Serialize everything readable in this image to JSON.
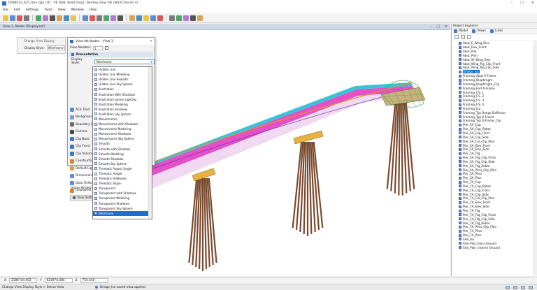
{
  "window": {
    "title": "D098035_A35_AS+.dgn [3D - V8 DGN, Read Only] - Bentley View V8i (SELECTseries 4)"
  },
  "menu": [
    "File",
    "Edit",
    "Settings",
    "Tools",
    "View",
    "Window",
    "Help"
  ],
  "view": {
    "title": "View 1, Model [Displayset]"
  },
  "change_view_display": {
    "title": "Change View Display",
    "label": "Display Style:",
    "value": "Wireframe"
  },
  "view_attributes": {
    "title": "View Attributes - View 1",
    "view_number_label": "View Number:",
    "view_number_value": "1",
    "section": "Presentation",
    "display_style_label": "Display Style:",
    "display_style_value": "Wireframe",
    "properties": [
      "ACS Triad",
      "Backgrounds",
      "Boundary Display",
      "Camera",
      "Clip Back",
      "Clip Front",
      "Clip Volume",
      "Constructions",
      "Default Lighting",
      "Dimensions",
      "Data Fields",
      "Displayset"
    ],
    "global_brightness": "Global Brightness",
    "view_settings": "View Settings"
  },
  "display_styles": [
    "Hidden Line",
    "Hidden Line Modeling",
    "Hidden Line Realistic",
    "Hidden Line Sky Sphere",
    "Illustration",
    "Illustration With Shadows",
    "Illustration Ignore Lighting",
    "Illustration Modeling",
    "Illustration Shadows",
    "Illustration Sky Sphere",
    "Monochrome",
    "Monochrome with Shadows",
    "Monochrome Modeling",
    "Monochrome Shadows",
    "Monochrome Sky Sphere",
    "Smooth",
    "Smooth with Shadows",
    "Smooth Modeling",
    "Smooth Shadows",
    "Smooth Sky Sphere",
    "Thematic Aspect Angle",
    "Thematic Height",
    "Thematic HillShade",
    "Thematic Slope",
    "Transparent",
    "Transparent with Shadows",
    "Transparent Modeling",
    "Transparent Shadows",
    "Transparent Sky Sphere",
    "Wireframe"
  ],
  "selected_style": "Wireframe",
  "project_explorer": {
    "title": "Project Explorer",
    "tabs": [
      "Model",
      "Views",
      "Links"
    ],
    "items": [
      "Abut_E_Wing_Elev",
      "Abut_Elev_Front",
      "Abut_Pile",
      "Abut_Plan",
      "Abut_W_Wing_Elev",
      "Abut_Wing_Pig_Clip_Front",
      "Abut_Wing_Pig_Clip_Side",
      "Bridge_Iso",
      "Framing_Abut A-Frame",
      "Framing_Diaphragm",
      "Framing_Diaphragm_Clip",
      "Framing_End X-Frame",
      "Framing_F.S. 1",
      "Framing_F.S. 2",
      "Framing_F.S. 3",
      "Framing_F.S. 4",
      "Framing_Iso",
      "Framing_Typ Range Deflector",
      "Framing_Typ X-Frame",
      "Framing_Typ X-Frame_Clip",
      "Pier_5A_Cap",
      "Pier_5A_Cap_Rebar",
      "Pier_5A_Clip_Front",
      "Pier_5A_Clip_Side",
      "Pier_5A_Col_Clip_Plan",
      "Pier_5A_Elev_Front",
      "Pier_5A_Elev_Side",
      "Pier_5A_Ftg",
      "Pier_5A_Ftg_Clip_Front",
      "Pier_5A_Ftg_Clip_Side",
      "Pier_5A_Ftg_Rebar",
      "Pier_5A_Piles_Clip_Plan",
      "Pier_5A_Piles",
      "Pier_5A_Plan",
      "Pier_7A_Cap",
      "Pier_7A_Cap_Rebar",
      "Pier_7A_Clip_Front",
      "Pier_7A_Clip_Side",
      "Pier_7A_Col_Clip_Plan",
      "Pier_7A_Elev_Front",
      "Pier_7A_Elev_Side",
      "Pier_7A_Ftg",
      "Pier_7A_Ftg_Clip_Front",
      "Pier_7A_Ftg_Clip_Side",
      "Pier_7A_Ftg_Rebar",
      "Pier_7A_Piles_Clip_Plan",
      "Pier_7A_Piles",
      "Pier_7A_Plan",
      "Site_Iso",
      "Site_Plan_Exist Ground",
      "Site_Plan_Interim Ground"
    ],
    "selected": "Bridge_Iso"
  },
  "coordinates": {
    "x_label": "X",
    "x": "2186744.402",
    "y_label": "Y",
    "y": "621974.384",
    "z_label": "Z",
    "z": "754.440"
  },
  "status": {
    "left": "Change View Display Style > Select View",
    "message": "Bridge_Iso saved view applied"
  },
  "colors": {
    "selection": "#1a6fd0",
    "deck_pink": "#e64fc5",
    "deck_cyan": "#38c3d8",
    "piles": "#7a4a2e",
    "pier_cap": "#e9b23f"
  }
}
